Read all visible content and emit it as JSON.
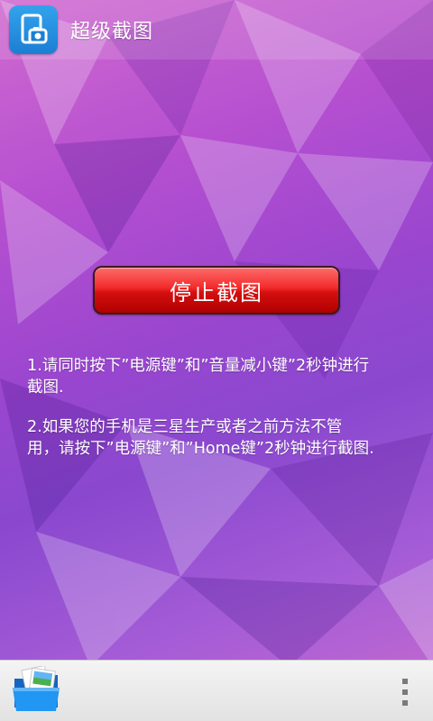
{
  "app": {
    "title": "超级截图"
  },
  "main": {
    "stop_button_label": "停止截图",
    "instructions": [
      {
        "lines": [
          "1.请同时按下”电源键”和”音量减小键”2秒钟进行",
          "截图."
        ]
      },
      {
        "lines": [
          "2.如果您的手机是三星生产或者之前方法不管",
          "用，请按下”电源键”和”Home键”2秒钟进行截图."
        ]
      }
    ]
  },
  "icons": {
    "app": "phone-camera-icon",
    "gallery": "folder-photos-icon",
    "menu": "overflow-menu-icon"
  },
  "colors": {
    "accent_red": "#e01515",
    "app_icon_blue": "#1b7fd4",
    "background_purple": "#9a46cf",
    "background_pink": "#d06ad0"
  }
}
